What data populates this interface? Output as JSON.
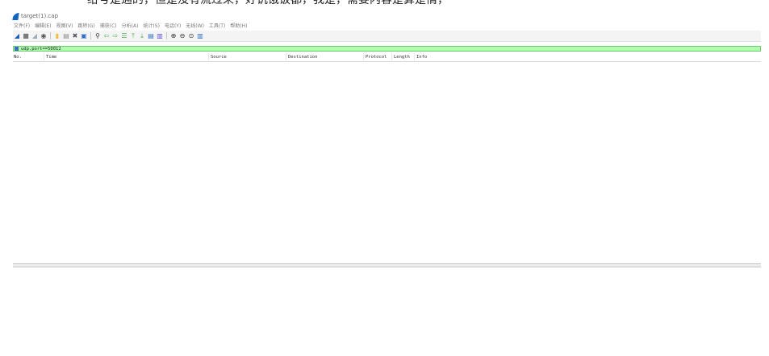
{
  "top_caption": "给号是通的，但是没有流过来，好饥饿饭都，我是，需要内容是算是情，",
  "window": {
    "title": "target(1).cap"
  },
  "menu": [
    "文件(F)",
    "编辑(E)",
    "视图(V)",
    "跳转(G)",
    "捕获(C)",
    "分析(A)",
    "统计(S)",
    "电话(Y)",
    "无线(W)",
    "工具(T)",
    "帮助(H)"
  ],
  "toolbar": {
    "icons": [
      {
        "name": "start-capture-icon",
        "glyph": "◢",
        "color": "#1e5eb8"
      },
      {
        "name": "stop-capture-icon",
        "glyph": "■",
        "color": "#7a7a7a"
      },
      {
        "name": "restart-capture-icon",
        "glyph": "◢",
        "color": "#9ab"
      },
      {
        "name": "capture-options-icon",
        "glyph": "◉",
        "color": "#555"
      },
      {
        "sep": true
      },
      {
        "name": "open-file-icon",
        "glyph": "▮",
        "color": "#f0c040"
      },
      {
        "name": "save-file-icon",
        "glyph": "▤",
        "color": "#8a8a8a"
      },
      {
        "name": "close-file-icon",
        "glyph": "✖",
        "color": "#556"
      },
      {
        "name": "reload-file-icon",
        "glyph": "▣",
        "color": "#2f6fbf"
      },
      {
        "sep": true
      },
      {
        "name": "find-packet-icon",
        "glyph": "⚲",
        "color": "#333"
      },
      {
        "name": "go-back-icon",
        "glyph": "⇦",
        "color": "#4caf50"
      },
      {
        "name": "go-forward-icon",
        "glyph": "⇨",
        "color": "#4caf50"
      },
      {
        "name": "go-to-packet-icon",
        "glyph": "☰",
        "color": "#4caf50"
      },
      {
        "name": "first-packet-icon",
        "glyph": "⤒",
        "color": "#4caf50"
      },
      {
        "name": "last-packet-icon",
        "glyph": "⤓",
        "color": "#4caf50"
      },
      {
        "name": "autoscroll-icon",
        "glyph": "▤",
        "color": "#2f6fbf"
      },
      {
        "name": "colorize-icon",
        "glyph": "▥",
        "color": "#5b4fcf"
      },
      {
        "sep": true
      },
      {
        "name": "zoom-in-icon",
        "glyph": "⊕",
        "color": "#333"
      },
      {
        "name": "zoom-out-icon",
        "glyph": "⊖",
        "color": "#333"
      },
      {
        "name": "normal-size-icon",
        "glyph": "⊙",
        "color": "#333"
      },
      {
        "name": "resize-columns-icon",
        "glyph": "▥",
        "color": "#2f6fbf"
      }
    ]
  },
  "filter": {
    "value": "udp.port==50012",
    "bg_color": "#afffaf"
  },
  "columns": [
    "No.",
    "Time",
    "Source",
    "Destination",
    "Protocol",
    "Length",
    "Info"
  ],
  "packets": []
}
